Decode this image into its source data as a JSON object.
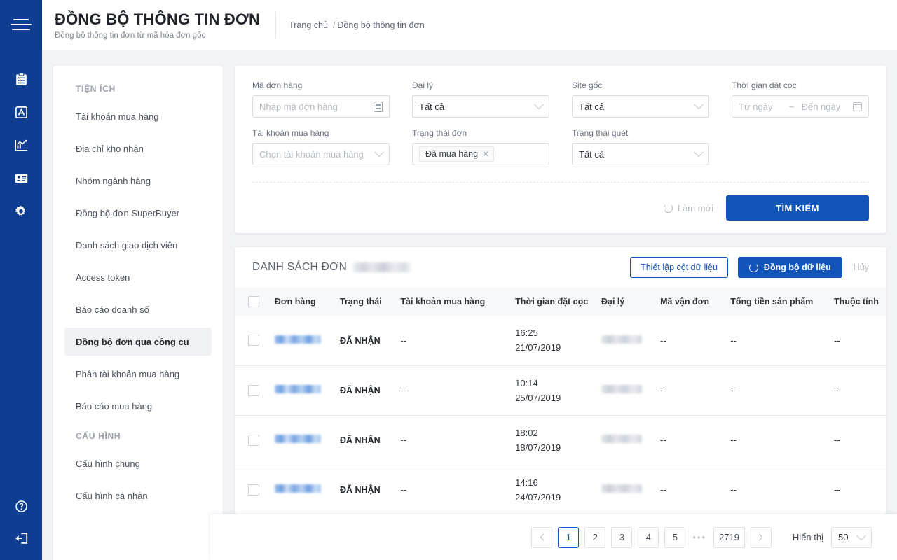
{
  "header": {
    "title": "ĐỒNG BỘ THÔNG TIN ĐƠN",
    "subtitle": "Đồng bộ thông tin đơn từ mã hóa đơn gốc",
    "breadcrumb_home": "Trang chủ",
    "breadcrumb_sep": "/",
    "breadcrumb_current": "Đồng bộ thông tin đơn",
    "menu_icon": "hamburger-icon"
  },
  "rail": {
    "icons": [
      "clipboard-list-icon",
      "box-archive-icon",
      "chart-analytics-icon",
      "id-card-icon",
      "gear-icon"
    ],
    "bottom_icons": [
      "help-circle-icon",
      "logout-icon"
    ]
  },
  "sidebar": {
    "groups": [
      {
        "title": "TIỆN ÍCH",
        "items": [
          {
            "label": "Tài khoản mua hàng",
            "active": false
          },
          {
            "label": "Địa chỉ kho nhận",
            "active": false
          },
          {
            "label": "Nhóm ngành hàng",
            "active": false
          },
          {
            "label": "Đồng bộ đơn SuperBuyer",
            "active": false
          },
          {
            "label": "Danh sách giao dịch viên",
            "active": false
          },
          {
            "label": "Access token",
            "active": false
          },
          {
            "label": "Báo cáo doanh số",
            "active": false
          },
          {
            "label": "Đồng bộ đơn qua công cụ",
            "active": true
          },
          {
            "label": "Phân tài khoản mua hàng",
            "active": false
          },
          {
            "label": "Báo cáo mua hàng",
            "active": false
          }
        ]
      },
      {
        "title": "CẤU HÌNH",
        "items": [
          {
            "label": "Cấu hình chung",
            "active": false
          },
          {
            "label": "Cấu hình cá nhân",
            "active": false
          }
        ]
      }
    ]
  },
  "filters": {
    "order_code": {
      "label": "Mã đơn hàng",
      "placeholder": "Nhập mã đơn hàng",
      "value": "",
      "icon": "barcode-scan-icon"
    },
    "agent": {
      "label": "Đại lý",
      "value": "Tất cả",
      "icon": "chevron-down-icon"
    },
    "origin_site": {
      "label": "Site gốc",
      "value": "Tất cả",
      "icon": "chevron-down-icon"
    },
    "deposit_time": {
      "label": "Thời gian đặt cọc",
      "from_placeholder": "Từ ngày",
      "separator": "~",
      "to_placeholder": "Đến ngày",
      "icon": "calendar-icon"
    },
    "buy_account": {
      "label": "Tài khoản mua hàng",
      "placeholder": "Chọn tài khoản mua hàng",
      "value": "",
      "icon": "chevron-down-icon"
    },
    "order_status": {
      "label": "Trạng thái đơn",
      "tags": [
        "Đã mua hàng"
      ],
      "tag_remove_icon": "close-icon"
    },
    "scan_status": {
      "label": "Trạng thái quét",
      "value": "Tất cả",
      "icon": "chevron-down-icon"
    },
    "refresh_label": "Làm mới",
    "refresh_icon": "refresh-icon",
    "search_label": "TÌM KIẾM"
  },
  "list": {
    "title": "DANH SÁCH ĐƠN",
    "count_redacted": true,
    "setup_columns_label": "Thiết lập cột dữ liệu",
    "sync_label": "Đồng bộ dữ liệu",
    "sync_icon": "refresh-icon",
    "cancel_label": "Hủy",
    "columns": [
      "Đơn hàng",
      "Trạng thái",
      "Tài khoản mua hàng",
      "Thời gian đặt cọc",
      "Đại lý",
      "Mã vận đơn",
      "Tổng tiền sản phẩm",
      "Thuộc tính"
    ],
    "rows": [
      {
        "order_code": "",
        "order_code_redacted": true,
        "status": "ĐÃ NHẬN",
        "buy_account": "--",
        "deposit_time_hour": "16:25",
        "deposit_time_date": "21/07/2019",
        "agent": "",
        "agent_redacted": true,
        "tracking_code": "--",
        "total_amount": "--",
        "attribute": "--"
      },
      {
        "order_code": "",
        "order_code_redacted": true,
        "status": "ĐÃ NHẬN",
        "buy_account": "--",
        "deposit_time_hour": "10:14",
        "deposit_time_date": "25/07/2019",
        "agent": "",
        "agent_redacted": true,
        "tracking_code": "--",
        "total_amount": "--",
        "attribute": "--"
      },
      {
        "order_code": "",
        "order_code_redacted": true,
        "status": "ĐÃ NHẬN",
        "buy_account": "--",
        "deposit_time_hour": "18:02",
        "deposit_time_date": "18/07/2019",
        "agent": "",
        "agent_redacted": true,
        "tracking_code": "--",
        "total_amount": "--",
        "attribute": "--"
      },
      {
        "order_code": "",
        "order_code_redacted": true,
        "status": "ĐÃ NHẬN",
        "buy_account": "--",
        "deposit_time_hour": "14:16",
        "deposit_time_date": "24/07/2019",
        "agent": "",
        "agent_redacted": true,
        "tracking_code": "--",
        "total_amount": "--",
        "attribute": "--"
      }
    ]
  },
  "pagination": {
    "prev_icon": "chevron-left-icon",
    "next_icon": "chevron-right-icon",
    "pages": [
      "1",
      "2",
      "3",
      "4",
      "5"
    ],
    "active_page": "1",
    "ellipsis": "•••",
    "last_page": "2719",
    "show_label": "Hiển thị",
    "page_size": "50",
    "page_size_icon": "chevron-down-icon"
  },
  "colors": {
    "brand_blue": "#0f3d91",
    "accent_blue": "#1155ba",
    "page_bg": "#f2f3f7"
  }
}
